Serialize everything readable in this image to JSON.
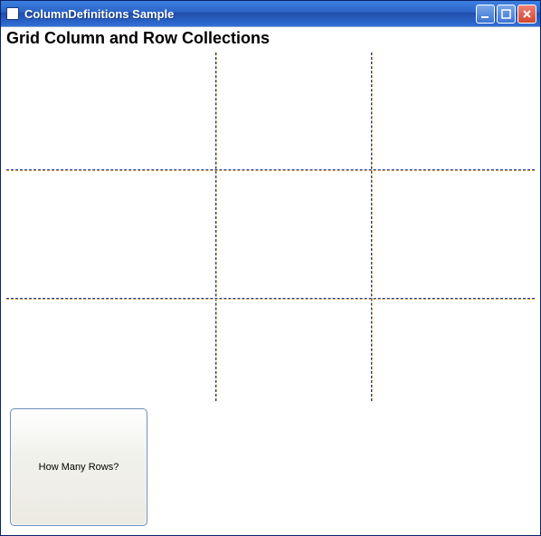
{
  "window": {
    "title": "ColumnDefinitions Sample"
  },
  "content": {
    "heading": "Grid Column and Row Collections",
    "button_label": "How Many Rows?"
  },
  "grid": {
    "columns": 3,
    "rows": 3
  }
}
